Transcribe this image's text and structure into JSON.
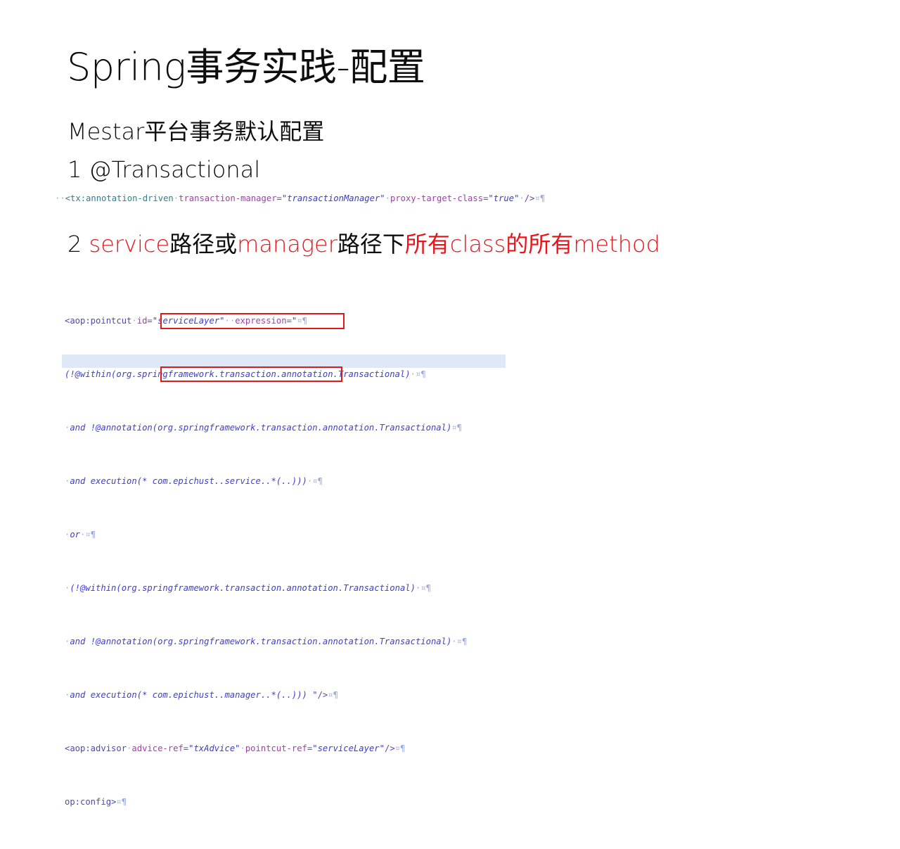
{
  "slide": {
    "title": "Spring事务实践-配置",
    "subheads": [
      "Mestar平台事务默认配置",
      "1 @Transactional"
    ],
    "section2": {
      "prefix": "2 ",
      "word_service": "service",
      "mid1": "路径或",
      "word_manager": "manager",
      "mid2": "路径下",
      "tail_red": "所有class的所有method"
    },
    "colors": {
      "red_text": "#e8161a",
      "red_box": "#e01b17",
      "selection": "#dfe8f7",
      "code_default": "#3f3f9e",
      "tag_teal": "#2f7f8f",
      "attr_purple": "#a040a8",
      "value_blue": "#3a3ad0"
    },
    "marks": {
      "space_dot": "·",
      "symbol": "¤",
      "pilcrow": "¶"
    },
    "code_block_1": {
      "line": {
        "lead_spaces": "··",
        "tag": "<tx:annotation-driven",
        "attr1": "transaction-manager",
        "val1": "\"transactionManager\"",
        "attr2": "proxy-target-class",
        "val2": "\"true\"",
        "close": "/>"
      }
    },
    "code_block_2": {
      "lines": [
        {
          "id": "pointcut-open",
          "tag": "<aop:pointcut",
          "attr1": "id",
          "val1": "\"serviceLayer\"",
          "attr2": "expression",
          "val2": "\""
        },
        {
          "id": "within-1",
          "text": "(!@within(org.springframework.transaction.annotation.Transactional)"
        },
        {
          "id": "annotation-1",
          "text": "and !@annotation(org.springframework.transaction.annotation.Transactional)"
        },
        {
          "id": "execution-service",
          "prefix": "and execution(* ",
          "boxed": "com.epichust..service..*(..)))"
        },
        {
          "id": "or",
          "text": "or"
        },
        {
          "id": "within-2",
          "text": "(!@within(org.springframework.transaction.annotation.Transactional)"
        },
        {
          "id": "annotation-2",
          "text": "and !@annotation(org.springframework.transaction.annotation.Transactional)"
        },
        {
          "id": "execution-manager",
          "prefix": "and execution(* ",
          "boxed": "com.epichust..manager..*(..))) \"",
          "suffix": "/>"
        },
        {
          "id": "advisor",
          "tag": "<aop:advisor",
          "attr1": "advice-ref",
          "val1": "\"txAdvice\"",
          "attr2": "pointcut-ref",
          "val2": "\"serviceLayer\"",
          "close": "/>"
        },
        {
          "id": "config-close",
          "text": "op:config>"
        }
      ]
    }
  }
}
